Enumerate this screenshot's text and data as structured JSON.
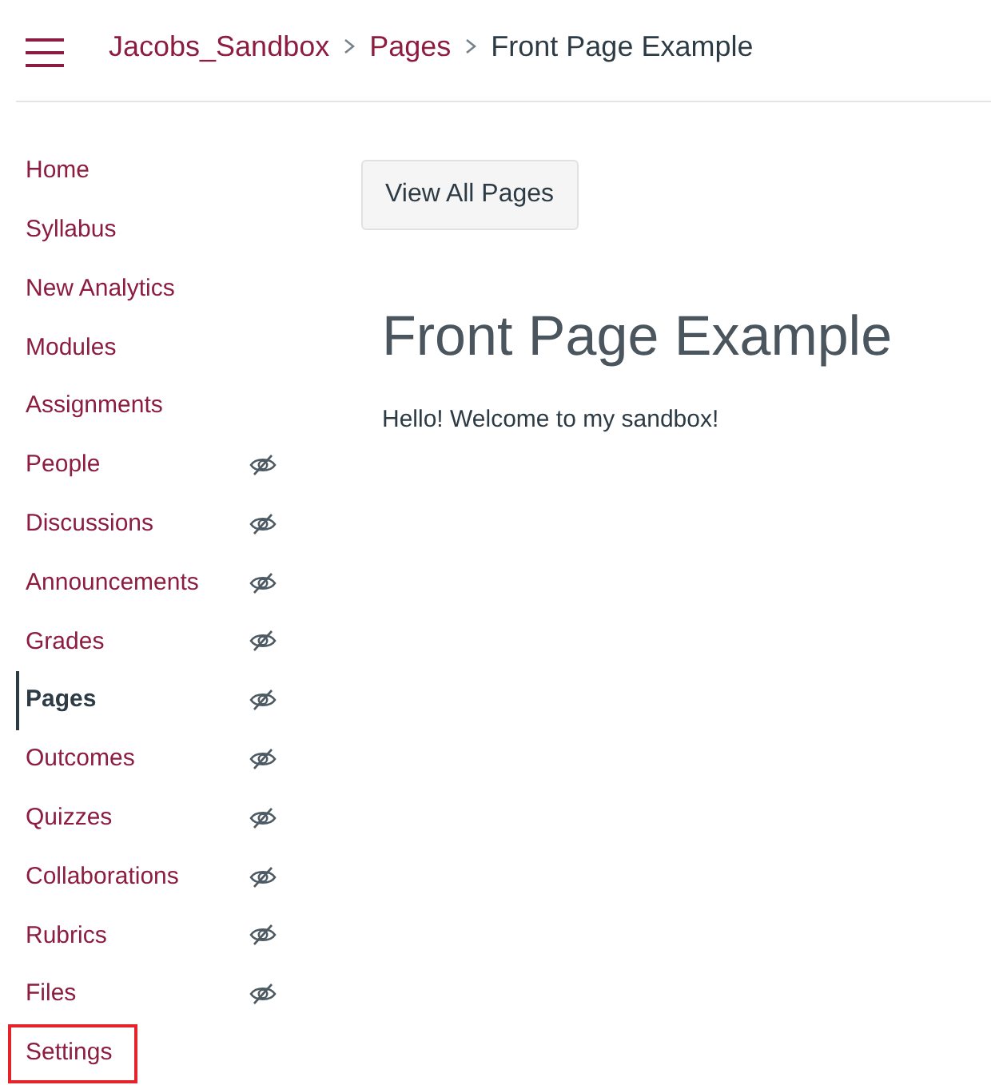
{
  "header": {
    "breadcrumbs": [
      {
        "label": "Jacobs_Sandbox",
        "kind": "link"
      },
      {
        "label": "Pages",
        "kind": "link"
      },
      {
        "label": "Front Page Example",
        "kind": "current"
      }
    ]
  },
  "sidebar": {
    "items": [
      {
        "label": "Home",
        "selected": false,
        "hidden": false,
        "highlighted": false
      },
      {
        "label": "Syllabus",
        "selected": false,
        "hidden": false,
        "highlighted": false
      },
      {
        "label": "New Analytics",
        "selected": false,
        "hidden": false,
        "highlighted": false
      },
      {
        "label": "Modules",
        "selected": false,
        "hidden": false,
        "highlighted": false
      },
      {
        "label": "Assignments",
        "selected": false,
        "hidden": false,
        "highlighted": false
      },
      {
        "label": "People",
        "selected": false,
        "hidden": true,
        "highlighted": false
      },
      {
        "label": "Discussions",
        "selected": false,
        "hidden": true,
        "highlighted": false
      },
      {
        "label": "Announcements",
        "selected": false,
        "hidden": true,
        "highlighted": false
      },
      {
        "label": "Grades",
        "selected": false,
        "hidden": true,
        "highlighted": false
      },
      {
        "label": "Pages",
        "selected": true,
        "hidden": true,
        "highlighted": false
      },
      {
        "label": "Outcomes",
        "selected": false,
        "hidden": true,
        "highlighted": false
      },
      {
        "label": "Quizzes",
        "selected": false,
        "hidden": true,
        "highlighted": false
      },
      {
        "label": "Collaborations",
        "selected": false,
        "hidden": true,
        "highlighted": false
      },
      {
        "label": "Rubrics",
        "selected": false,
        "hidden": true,
        "highlighted": false
      },
      {
        "label": "Files",
        "selected": false,
        "hidden": true,
        "highlighted": false
      },
      {
        "label": "Settings",
        "selected": false,
        "hidden": false,
        "highlighted": true
      }
    ]
  },
  "content": {
    "button": "View All Pages",
    "title": "Front Page Example",
    "body": "Hello! Welcome to my sandbox!"
  }
}
